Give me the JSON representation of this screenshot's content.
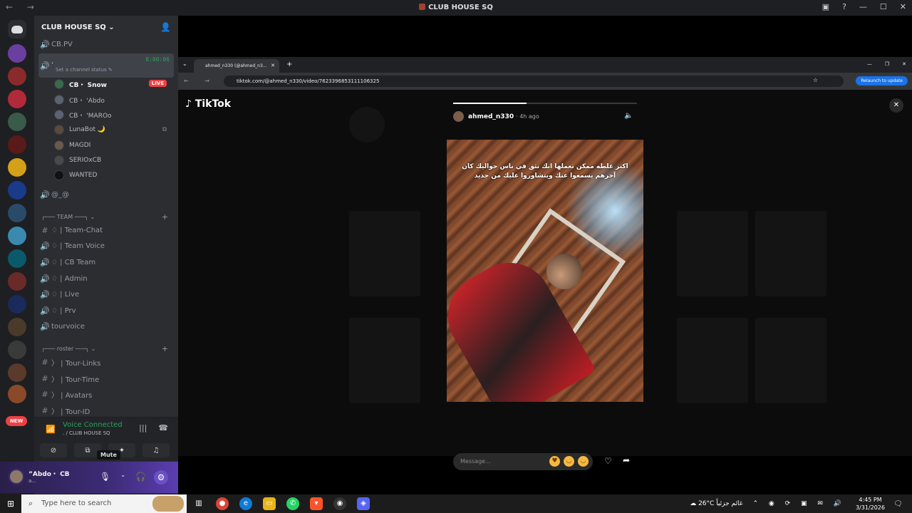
{
  "window": {
    "title": "CLUB HOUSE SQ"
  },
  "guild": {
    "name": "CLUB HOUSE SQ ⌄"
  },
  "servers": {
    "new_badge": "NEW"
  },
  "channels": {
    "cbpv": "CB.PV",
    "active": {
      "name": ".",
      "timer": "8:00:06",
      "status": "Set a channel status ✎"
    },
    "members": [
      {
        "name": "CB・ Snow",
        "live": "LIVE"
      },
      {
        "name": "CB・ 'Abdo"
      },
      {
        "name": "CB・ 'MAROo"
      },
      {
        "name": "LunaBot 🌙"
      },
      {
        "name": "MAGDI"
      },
      {
        "name": "SERIOxCB"
      },
      {
        "name": "WANTED"
      }
    ],
    "at": "@_@",
    "team_category": "╭─── TEAM ───╮ ⌄",
    "team": [
      "♢ | Team-Chat",
      "♢ | Team Voice",
      "♢ | CB Team",
      "♢ | Admin",
      "♢ | Live",
      "♢ | Prv"
    ],
    "tourvoice": "tourvoice",
    "roster_category": "╭─── roster ───╮ ⌄",
    "roster": [
      "〉 | Tour-Links",
      "〉 | Tour-Time",
      "〉 | Avatars",
      "〉 | Tour-ID"
    ]
  },
  "voice": {
    "connected": "Voice Connected",
    "sub": ". / CLUB HOUSE SQ",
    "tooltip": "Mute"
  },
  "user": {
    "name": "”Abdo・ CB",
    "status": "a..."
  },
  "browser": {
    "tab_title": "ahmed_n330 (@ahmed_n3...",
    "url": "tiktok.com/@ahmed_n330/video/7623396853111106325",
    "relaunch": "Relaunch to update"
  },
  "tiktok": {
    "logo": "TikTok",
    "username": "ahmed_n330",
    "ago": "· 4h ago",
    "caption": "اكتر غلطه ممكن تعملها انك تثق في ناس حواليك كان آخرهم يسمعوا عنك ويتشاوروا عليك من جديد",
    "progress": 0.4,
    "reply_placeholder": "Message..."
  },
  "taskbar": {
    "search_placeholder": "Type here to search",
    "weather": "26°C  غائم جزئياً",
    "time": "4:45 PM",
    "date": "3/31/2026"
  }
}
